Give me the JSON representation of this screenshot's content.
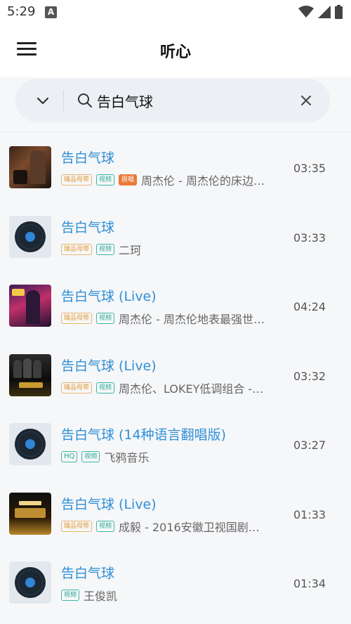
{
  "status_bar": {
    "time": "5:29",
    "notification_letter": "A"
  },
  "app_bar": {
    "title": "听心"
  },
  "search": {
    "query": "告白气球"
  },
  "tags": {
    "hq": "臻品母带",
    "mv": "视频",
    "original": "原唱",
    "hq_short": "HQ"
  },
  "songs": [
    {
      "title": "告白气球",
      "artist": "周杰伦 - 周杰伦的床边…",
      "duration": "03:35",
      "cover": "album-cover-1",
      "tags": [
        "hq",
        "mv",
        "original"
      ]
    },
    {
      "title": "告白气球",
      "artist": "二珂",
      "duration": "03:33",
      "cover": "vinyl-disc-icon",
      "tags": [
        "hq",
        "mv"
      ]
    },
    {
      "title": "告白气球 (Live)",
      "artist": "周杰伦 - 周杰伦地表最强世…",
      "duration": "04:24",
      "cover": "album-cover-2",
      "tags": [
        "hq",
        "mv"
      ]
    },
    {
      "title": "告白气球 (Live)",
      "artist": "周杰伦、LOKEY低调组合 -…",
      "duration": "03:32",
      "cover": "album-cover-3",
      "tags": [
        "hq",
        "mv"
      ]
    },
    {
      "title": "告白气球 (14种语言翻唱版)",
      "artist": "飞鸦音乐",
      "duration": "03:27",
      "cover": "vinyl-disc-icon",
      "tags": [
        "hq_short",
        "mv"
      ]
    },
    {
      "title": "告白气球 (Live)",
      "artist": "成毅 - 2016安徽卫视国剧…",
      "duration": "01:33",
      "cover": "album-cover-4",
      "tags": [
        "hq",
        "mv"
      ]
    },
    {
      "title": "告白气球",
      "artist": "王俊凯",
      "duration": "01:34",
      "cover": "vinyl-disc-icon",
      "tags": [
        "mv"
      ]
    }
  ]
}
